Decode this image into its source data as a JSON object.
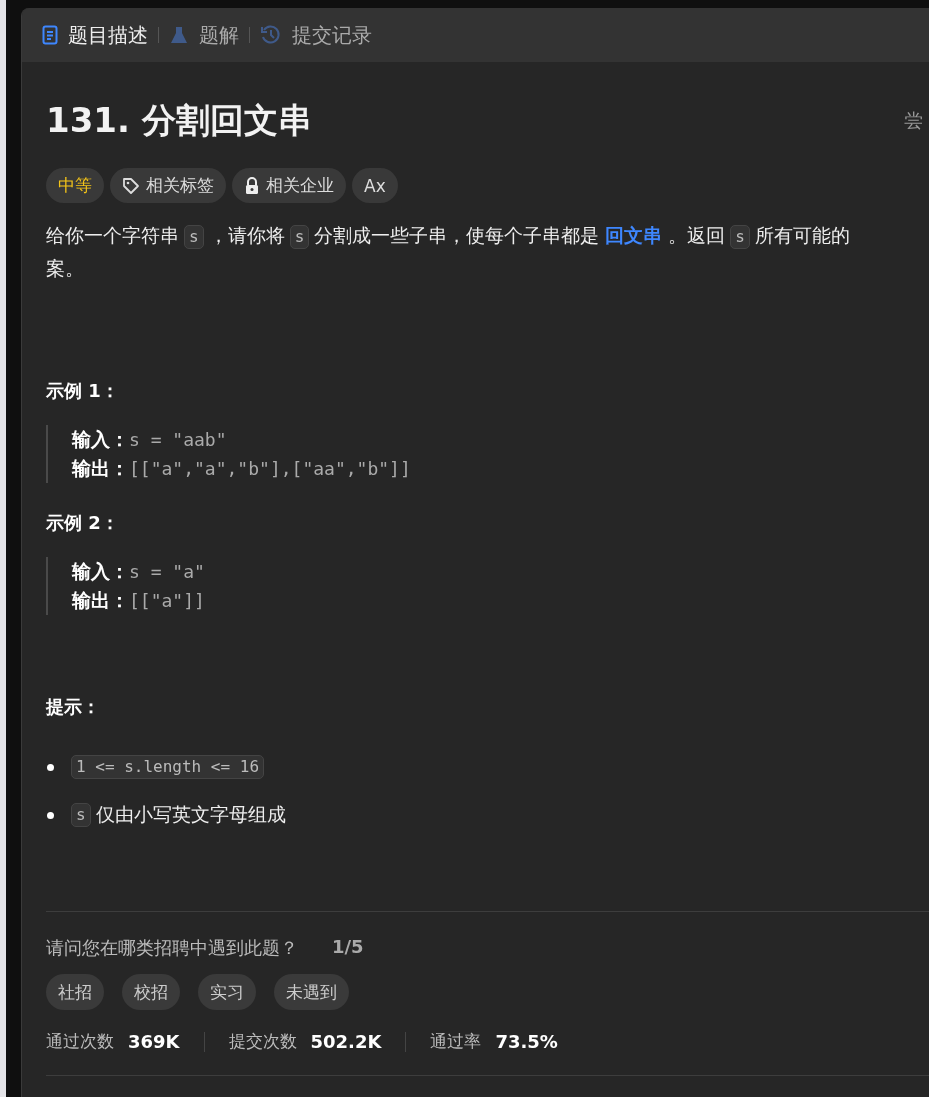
{
  "tabs": [
    {
      "label": "题目描述",
      "kind": "doc",
      "selected": true
    },
    {
      "label": "题解",
      "kind": "flask",
      "selected": false
    },
    {
      "label": "提交记录",
      "kind": "history",
      "selected": false
    }
  ],
  "title": "131. 分割回文串",
  "try_label": "尝",
  "chips": [
    {
      "kind": "difficulty",
      "label": "中等"
    },
    {
      "kind": "tag",
      "label": "相关标签"
    },
    {
      "kind": "lock",
      "label": "相关企业"
    },
    {
      "kind": "translate",
      "label": "Ax"
    }
  ],
  "description": [
    [
      {
        "kind": "text",
        "text": "给你一个字符串"
      },
      {
        "kind": "code",
        "text": "s"
      },
      {
        "kind": "text",
        "text": "，请你将"
      },
      {
        "kind": "code",
        "text": "s"
      },
      {
        "kind": "text",
        "text": "分割成一些子串，使每个子串都是"
      },
      {
        "kind": "link",
        "text": "回文串"
      },
      {
        "kind": "text",
        "text": "。返回"
      },
      {
        "kind": "code",
        "text": "s"
      },
      {
        "kind": "text",
        "text": "所有可能的"
      }
    ],
    [
      {
        "kind": "text",
        "text": "案。"
      }
    ]
  ],
  "examples": [
    {
      "title": "示例 1：",
      "rows": [
        {
          "label": "输入：",
          "value": "s = \"aab\""
        },
        {
          "label": "输出：",
          "value": "[[\"a\",\"a\",\"b\"],[\"aa\",\"b\"]]"
        }
      ]
    },
    {
      "title": "示例 2：",
      "rows": [
        {
          "label": "输入：",
          "value": "s = \"a\""
        },
        {
          "label": "输出：",
          "value": "[[\"a\"]]"
        }
      ]
    }
  ],
  "hints_title": "提示：",
  "hints": [
    [
      {
        "kind": "code",
        "text": "1 <= s.length <= 16"
      }
    ],
    [
      {
        "kind": "code",
        "text": "s"
      },
      {
        "kind": "text",
        "text": "仅由小写英文字母组成"
      }
    ]
  ],
  "survey": {
    "question": "请问您在哪类招聘中遇到此题？",
    "progress": "1/5",
    "options": [
      "社招",
      "校招",
      "实习",
      "未遇到"
    ]
  },
  "stats": [
    {
      "label": "通过次数",
      "value": "369K"
    },
    {
      "label": "提交次数",
      "value": "502.2K"
    },
    {
      "label": "通过率",
      "value": "73.5%"
    }
  ]
}
